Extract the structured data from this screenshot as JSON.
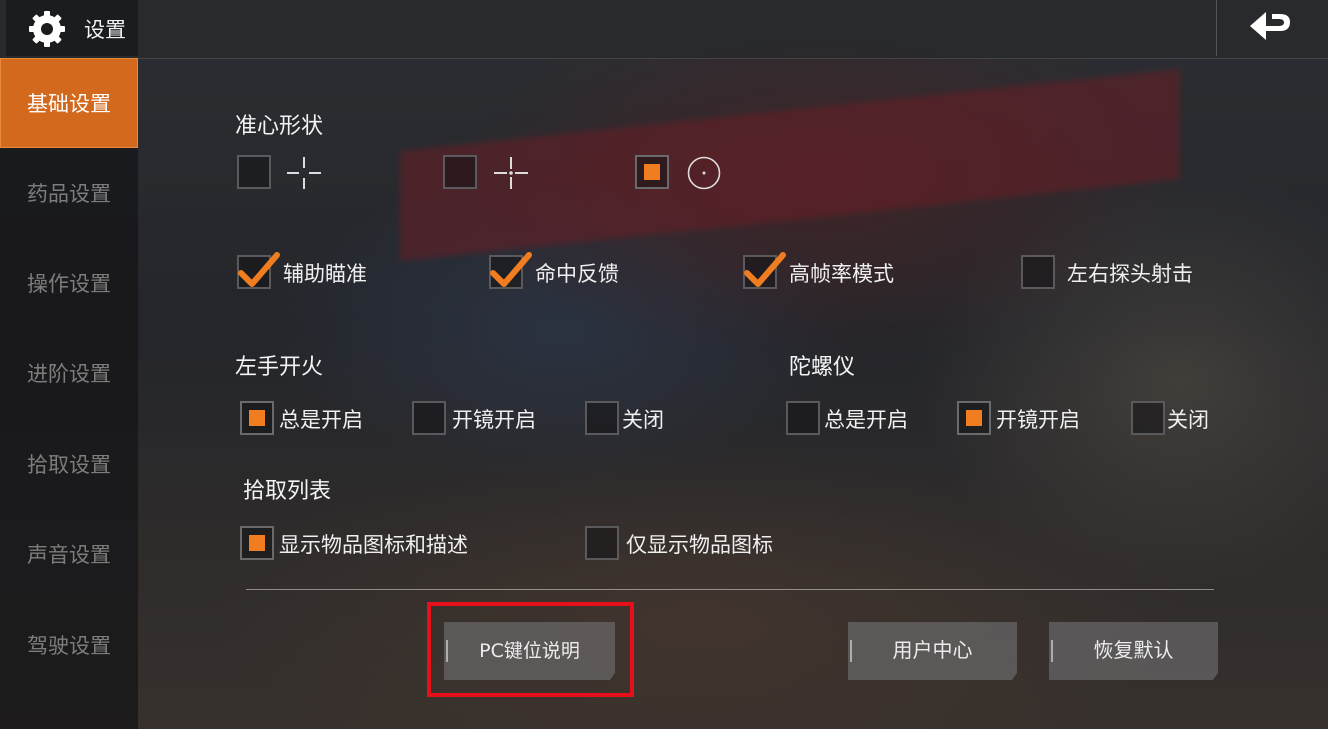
{
  "header": {
    "title": "设置",
    "back_icon": "return-arrow-icon",
    "settings_icon": "gear-icon"
  },
  "sidebar": {
    "items": [
      {
        "label": "基础设置",
        "active": true
      },
      {
        "label": "药品设置",
        "active": false
      },
      {
        "label": "操作设置",
        "active": false
      },
      {
        "label": "进阶设置",
        "active": false
      },
      {
        "label": "拾取设置",
        "active": false
      },
      {
        "label": "声音设置",
        "active": false
      },
      {
        "label": "驾驶设置",
        "active": false
      }
    ]
  },
  "crosshair": {
    "title": "准心形状",
    "options": [
      {
        "icon": "crosshair-gap-icon",
        "selected": false
      },
      {
        "icon": "crosshair-cross-icon",
        "selected": false
      },
      {
        "icon": "crosshair-circle-dot-icon",
        "selected": true
      }
    ]
  },
  "toggles": [
    {
      "label": "辅助瞄准",
      "checked": true
    },
    {
      "label": "命中反馈",
      "checked": true
    },
    {
      "label": "高帧率模式",
      "checked": true
    },
    {
      "label": "左右探头射击",
      "checked": false
    }
  ],
  "left_fire": {
    "title": "左手开火",
    "options": [
      {
        "label": "总是开启",
        "selected": true
      },
      {
        "label": "开镜开启",
        "selected": false
      },
      {
        "label": "关闭",
        "selected": false
      }
    ]
  },
  "gyroscope": {
    "title": "陀螺仪",
    "options": [
      {
        "label": "总是开启",
        "selected": false
      },
      {
        "label": "开镜开启",
        "selected": true
      },
      {
        "label": "关闭",
        "selected": false
      }
    ]
  },
  "pickup_list": {
    "title": "拾取列表",
    "options": [
      {
        "label": "显示物品图标和描述",
        "selected": true
      },
      {
        "label": "仅显示物品图标",
        "selected": false
      }
    ]
  },
  "buttons": {
    "pc_keys": "PC键位说明",
    "user_center": "用户中心",
    "restore_default": "恢复默认"
  },
  "colors": {
    "accent": "#f07e20",
    "sidebar_active": "#d3691c",
    "highlight": "#e6101a"
  }
}
